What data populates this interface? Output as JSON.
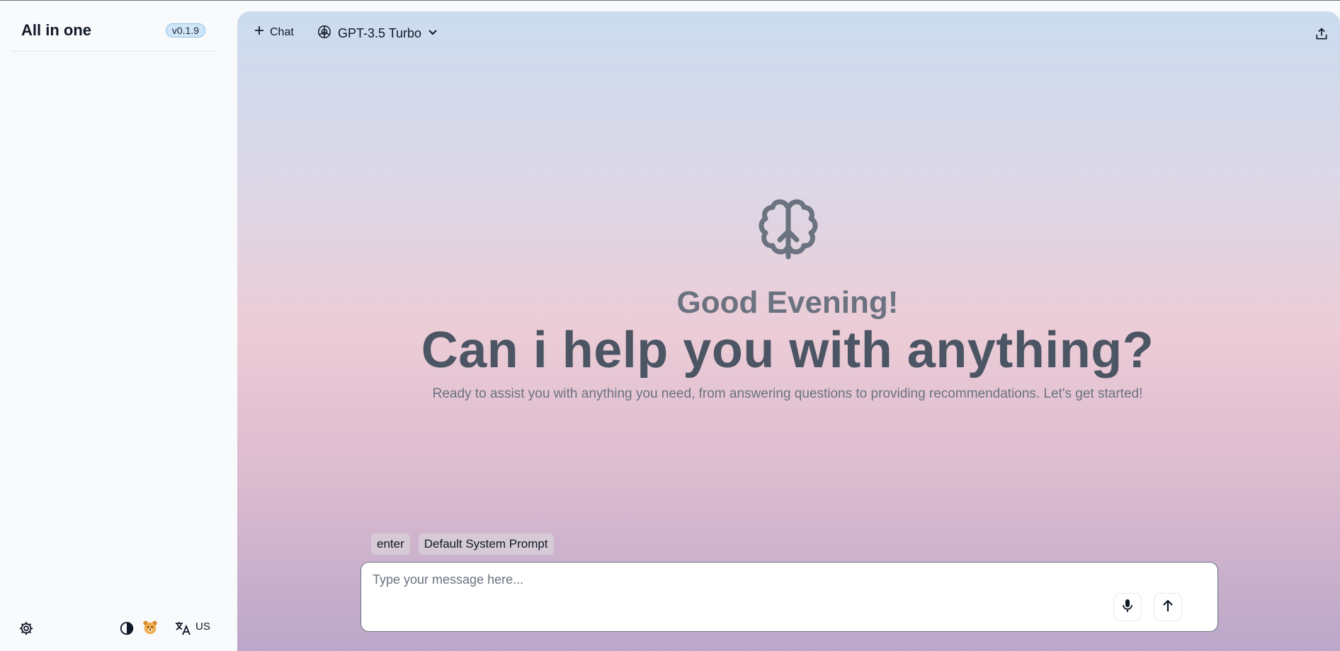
{
  "sidebar": {
    "app_title": "All in one",
    "version": "v0.1.9",
    "footer": {
      "settings_icon": "gear-icon",
      "theme_icon": "contrast-icon",
      "avatar_icon": "bear-avatar-icon",
      "language_icon": "translate-icon",
      "language_label": "US"
    }
  },
  "topbar": {
    "new_chat_label": "Chat",
    "model_name": "GPT-3.5 Turbo",
    "share_icon": "share-icon"
  },
  "hero": {
    "icon": "brain-icon",
    "greeting": "Good Evening!",
    "headline": "Can i help you with anything?",
    "subtitle": "Ready to assist you with anything you need, from answering questions to providing recommendations. Let's get started!"
  },
  "composer": {
    "chips": [
      "enter",
      "Default System Prompt"
    ],
    "placeholder": "Type your message here...",
    "value": ""
  },
  "colors": {
    "headline": "#4b5563",
    "greeting": "#6b7280",
    "version_badge_bg": "#cfe6f8"
  }
}
